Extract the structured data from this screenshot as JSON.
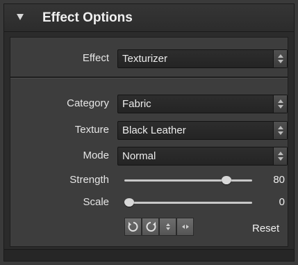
{
  "panel": {
    "title": "Effect Options"
  },
  "effect": {
    "label": "Effect",
    "value": "Texturizer"
  },
  "category": {
    "label": "Category",
    "value": "Fabric"
  },
  "texture": {
    "label": "Texture",
    "value": "Black Leather"
  },
  "mode": {
    "label": "Mode",
    "value": "Normal"
  },
  "strength": {
    "label": "Strength",
    "value": "80",
    "fraction": 0.8
  },
  "scale": {
    "label": "Scale",
    "value": "0",
    "fraction": 0.0
  },
  "tools": {
    "reset_label": "Reset",
    "icons": [
      "rotate-left-icon",
      "rotate-right-icon",
      "flip-vertical-icon",
      "flip-horizontal-icon"
    ]
  }
}
